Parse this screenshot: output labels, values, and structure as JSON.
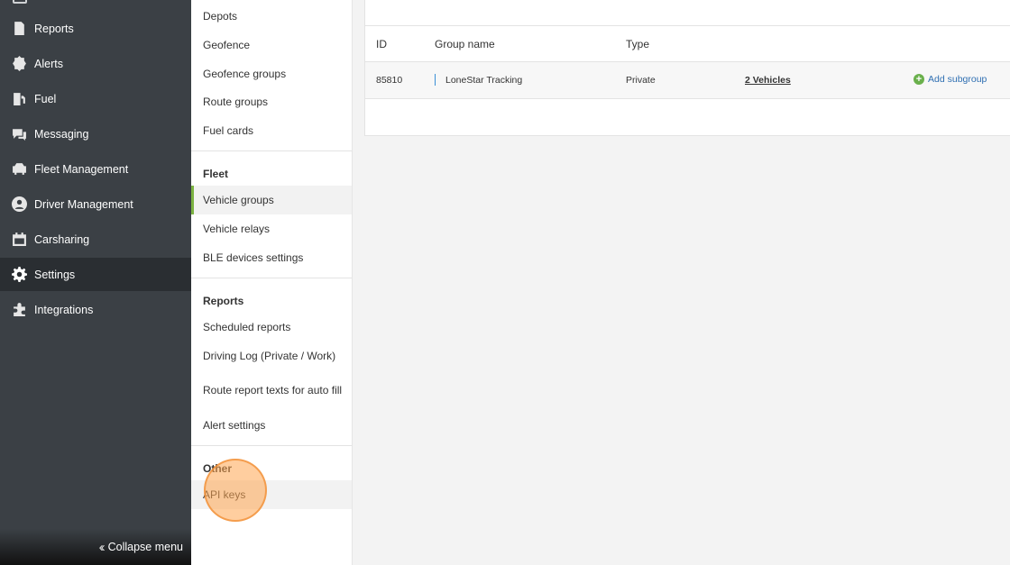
{
  "nav": {
    "items": [
      {
        "label": "Reports",
        "icon": "document-icon"
      },
      {
        "label": "Alerts",
        "icon": "alert-badge-icon"
      },
      {
        "label": "Fuel",
        "icon": "fuel-pump-icon"
      },
      {
        "label": "Messaging",
        "icon": "chat-icon"
      },
      {
        "label": "Fleet Management",
        "icon": "car-icon"
      },
      {
        "label": "Driver Management",
        "icon": "person-icon"
      },
      {
        "label": "Carsharing",
        "icon": "calendar-icon"
      },
      {
        "label": "Settings",
        "icon": "gear-icon",
        "active": true
      },
      {
        "label": "Integrations",
        "icon": "puzzle-icon"
      }
    ],
    "collapse_label": "Collapse menu"
  },
  "submenu": {
    "items_top": [
      "Depots",
      "Geofence",
      "Geofence groups",
      "Route groups",
      "Fuel cards"
    ],
    "fleet_heading": "Fleet",
    "fleet_items": [
      "Vehicle groups",
      "Vehicle relays",
      "BLE devices settings"
    ],
    "reports_heading": "Reports",
    "reports_items": [
      "Scheduled reports",
      "Driving Log (Private / Work)",
      "Route report texts for auto fill",
      "Alert settings"
    ],
    "other_heading": "Other",
    "other_items": [
      "API keys"
    ]
  },
  "table": {
    "headers": {
      "id": "ID",
      "name": "Group name",
      "type": "Type"
    },
    "rows": [
      {
        "id": "85810",
        "name": "LoneStar Tracking",
        "type": "Private",
        "vehicles": "2 Vehicles",
        "action": "Add subgroup"
      }
    ]
  },
  "colors": {
    "nav_bg": "#3b4045",
    "active_accent": "#7cb342",
    "link": "#2f6fb2"
  }
}
